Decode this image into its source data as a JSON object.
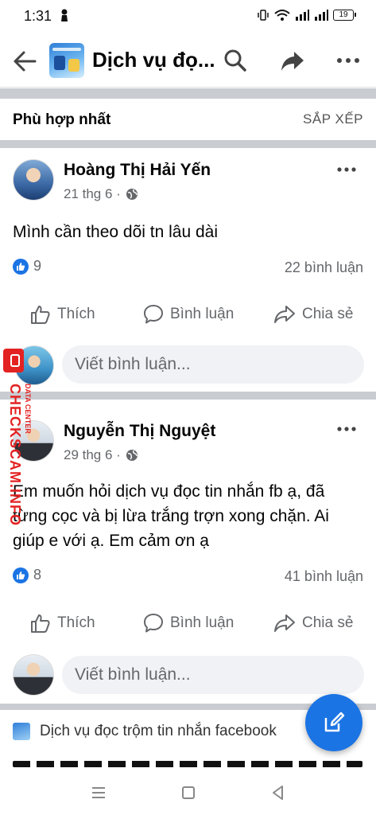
{
  "status_bar": {
    "time": "1:31",
    "battery": "19"
  },
  "app_bar": {
    "title": "Dịch vụ đọ..."
  },
  "sort": {
    "title": "Phù hợp nhất",
    "button": "SẮP XẾP"
  },
  "posts": [
    {
      "author": "Hoàng Thị Hải Yến",
      "date": "21 thg 6 ·",
      "text": "Mình cần theo dõi tn lâu dài",
      "likes": "9",
      "comments": "22 bình luận",
      "like_label": "Thích",
      "comment_label": "Bình luận",
      "share_label": "Chia sẻ",
      "comment_placeholder": "Viết bình luận..."
    },
    {
      "author": "Nguyễn Thị Nguyệt",
      "date": "29 thg 6 ·",
      "text": "Em muốn hỏi dịch vụ đọc tin nhắn fb ạ, đã từng cọc và bị lừa trắng trợn xong chặn. Ai giúp e với ạ. Em cảm ơn ạ",
      "likes": "8",
      "comments": "41 bình luận",
      "like_label": "Thích",
      "comment_label": "Bình luận",
      "share_label": "Chia sẻ",
      "comment_placeholder": "Viết bình luận..."
    }
  ],
  "watermark": {
    "text": "CHECKSCAM.INFO",
    "sub": "DATA CENTER"
  },
  "shared_post": {
    "text": "Dịch vụ đọc trộm tin nhắn facebook"
  },
  "colors": {
    "accent": "#1b74e4",
    "separator": "#c9ccd1",
    "watermark": "#e32222"
  }
}
